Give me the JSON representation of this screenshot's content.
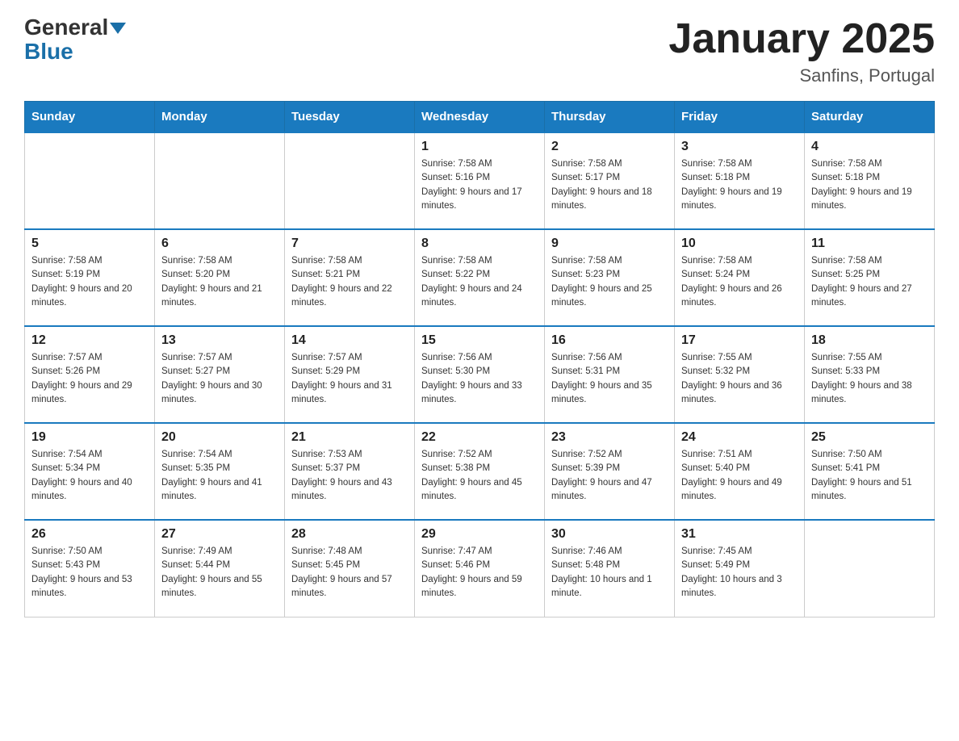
{
  "header": {
    "logo_general": "General",
    "logo_blue": "Blue",
    "title": "January 2025",
    "subtitle": "Sanfins, Portugal"
  },
  "days_of_week": [
    "Sunday",
    "Monday",
    "Tuesday",
    "Wednesday",
    "Thursday",
    "Friday",
    "Saturday"
  ],
  "weeks": [
    [
      null,
      null,
      null,
      {
        "date": "1",
        "sunrise": "Sunrise: 7:58 AM",
        "sunset": "Sunset: 5:16 PM",
        "daylight": "Daylight: 9 hours and 17 minutes."
      },
      {
        "date": "2",
        "sunrise": "Sunrise: 7:58 AM",
        "sunset": "Sunset: 5:17 PM",
        "daylight": "Daylight: 9 hours and 18 minutes."
      },
      {
        "date": "3",
        "sunrise": "Sunrise: 7:58 AM",
        "sunset": "Sunset: 5:18 PM",
        "daylight": "Daylight: 9 hours and 19 minutes."
      },
      {
        "date": "4",
        "sunrise": "Sunrise: 7:58 AM",
        "sunset": "Sunset: 5:18 PM",
        "daylight": "Daylight: 9 hours and 19 minutes."
      }
    ],
    [
      {
        "date": "5",
        "sunrise": "Sunrise: 7:58 AM",
        "sunset": "Sunset: 5:19 PM",
        "daylight": "Daylight: 9 hours and 20 minutes."
      },
      {
        "date": "6",
        "sunrise": "Sunrise: 7:58 AM",
        "sunset": "Sunset: 5:20 PM",
        "daylight": "Daylight: 9 hours and 21 minutes."
      },
      {
        "date": "7",
        "sunrise": "Sunrise: 7:58 AM",
        "sunset": "Sunset: 5:21 PM",
        "daylight": "Daylight: 9 hours and 22 minutes."
      },
      {
        "date": "8",
        "sunrise": "Sunrise: 7:58 AM",
        "sunset": "Sunset: 5:22 PM",
        "daylight": "Daylight: 9 hours and 24 minutes."
      },
      {
        "date": "9",
        "sunrise": "Sunrise: 7:58 AM",
        "sunset": "Sunset: 5:23 PM",
        "daylight": "Daylight: 9 hours and 25 minutes."
      },
      {
        "date": "10",
        "sunrise": "Sunrise: 7:58 AM",
        "sunset": "Sunset: 5:24 PM",
        "daylight": "Daylight: 9 hours and 26 minutes."
      },
      {
        "date": "11",
        "sunrise": "Sunrise: 7:58 AM",
        "sunset": "Sunset: 5:25 PM",
        "daylight": "Daylight: 9 hours and 27 minutes."
      }
    ],
    [
      {
        "date": "12",
        "sunrise": "Sunrise: 7:57 AM",
        "sunset": "Sunset: 5:26 PM",
        "daylight": "Daylight: 9 hours and 29 minutes."
      },
      {
        "date": "13",
        "sunrise": "Sunrise: 7:57 AM",
        "sunset": "Sunset: 5:27 PM",
        "daylight": "Daylight: 9 hours and 30 minutes."
      },
      {
        "date": "14",
        "sunrise": "Sunrise: 7:57 AM",
        "sunset": "Sunset: 5:29 PM",
        "daylight": "Daylight: 9 hours and 31 minutes."
      },
      {
        "date": "15",
        "sunrise": "Sunrise: 7:56 AM",
        "sunset": "Sunset: 5:30 PM",
        "daylight": "Daylight: 9 hours and 33 minutes."
      },
      {
        "date": "16",
        "sunrise": "Sunrise: 7:56 AM",
        "sunset": "Sunset: 5:31 PM",
        "daylight": "Daylight: 9 hours and 35 minutes."
      },
      {
        "date": "17",
        "sunrise": "Sunrise: 7:55 AM",
        "sunset": "Sunset: 5:32 PM",
        "daylight": "Daylight: 9 hours and 36 minutes."
      },
      {
        "date": "18",
        "sunrise": "Sunrise: 7:55 AM",
        "sunset": "Sunset: 5:33 PM",
        "daylight": "Daylight: 9 hours and 38 minutes."
      }
    ],
    [
      {
        "date": "19",
        "sunrise": "Sunrise: 7:54 AM",
        "sunset": "Sunset: 5:34 PM",
        "daylight": "Daylight: 9 hours and 40 minutes."
      },
      {
        "date": "20",
        "sunrise": "Sunrise: 7:54 AM",
        "sunset": "Sunset: 5:35 PM",
        "daylight": "Daylight: 9 hours and 41 minutes."
      },
      {
        "date": "21",
        "sunrise": "Sunrise: 7:53 AM",
        "sunset": "Sunset: 5:37 PM",
        "daylight": "Daylight: 9 hours and 43 minutes."
      },
      {
        "date": "22",
        "sunrise": "Sunrise: 7:52 AM",
        "sunset": "Sunset: 5:38 PM",
        "daylight": "Daylight: 9 hours and 45 minutes."
      },
      {
        "date": "23",
        "sunrise": "Sunrise: 7:52 AM",
        "sunset": "Sunset: 5:39 PM",
        "daylight": "Daylight: 9 hours and 47 minutes."
      },
      {
        "date": "24",
        "sunrise": "Sunrise: 7:51 AM",
        "sunset": "Sunset: 5:40 PM",
        "daylight": "Daylight: 9 hours and 49 minutes."
      },
      {
        "date": "25",
        "sunrise": "Sunrise: 7:50 AM",
        "sunset": "Sunset: 5:41 PM",
        "daylight": "Daylight: 9 hours and 51 minutes."
      }
    ],
    [
      {
        "date": "26",
        "sunrise": "Sunrise: 7:50 AM",
        "sunset": "Sunset: 5:43 PM",
        "daylight": "Daylight: 9 hours and 53 minutes."
      },
      {
        "date": "27",
        "sunrise": "Sunrise: 7:49 AM",
        "sunset": "Sunset: 5:44 PM",
        "daylight": "Daylight: 9 hours and 55 minutes."
      },
      {
        "date": "28",
        "sunrise": "Sunrise: 7:48 AM",
        "sunset": "Sunset: 5:45 PM",
        "daylight": "Daylight: 9 hours and 57 minutes."
      },
      {
        "date": "29",
        "sunrise": "Sunrise: 7:47 AM",
        "sunset": "Sunset: 5:46 PM",
        "daylight": "Daylight: 9 hours and 59 minutes."
      },
      {
        "date": "30",
        "sunrise": "Sunrise: 7:46 AM",
        "sunset": "Sunset: 5:48 PM",
        "daylight": "Daylight: 10 hours and 1 minute."
      },
      {
        "date": "31",
        "sunrise": "Sunrise: 7:45 AM",
        "sunset": "Sunset: 5:49 PM",
        "daylight": "Daylight: 10 hours and 3 minutes."
      },
      null
    ]
  ]
}
